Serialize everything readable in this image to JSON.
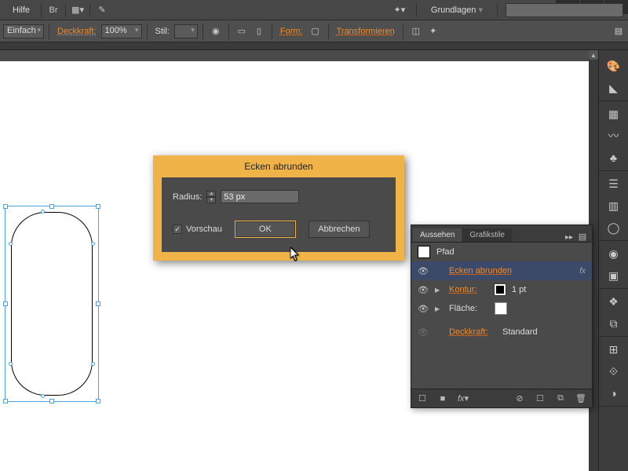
{
  "menubar": {
    "help": "Hilfe"
  },
  "workspace": {
    "label": "Grundlagen",
    "search_placeholder": ""
  },
  "controlbar": {
    "stroke_style": "Einfach",
    "opacity_label": "Deckkraft:",
    "opacity_value": "100%",
    "style_label": "Stil:",
    "form_label": "Form:",
    "transform_label": "Transformieren"
  },
  "dialog": {
    "title": "Ecken abrunden",
    "radius_label": "Radius:",
    "radius_value": "53 px",
    "preview_label": "Vorschau",
    "preview_checked": true,
    "ok_label": "OK",
    "cancel_label": "Abbrechen"
  },
  "appearance_panel": {
    "tabs": {
      "appearance": "Aussehen",
      "styles": "Grafikstile"
    },
    "target_label": "Pfad",
    "rows": {
      "effect": "Ecken abrunden",
      "stroke_label": "Kontur:",
      "stroke_value": "1 pt",
      "fill_label": "Fläche:",
      "opacity_label": "Deckkraft:",
      "opacity_value": "Standard"
    },
    "fx": "fx"
  },
  "win_controls": {
    "min": "—",
    "max": "☐",
    "close": "✕"
  },
  "colors": {
    "accent": "#f0b348",
    "link": "#f08b2a"
  }
}
